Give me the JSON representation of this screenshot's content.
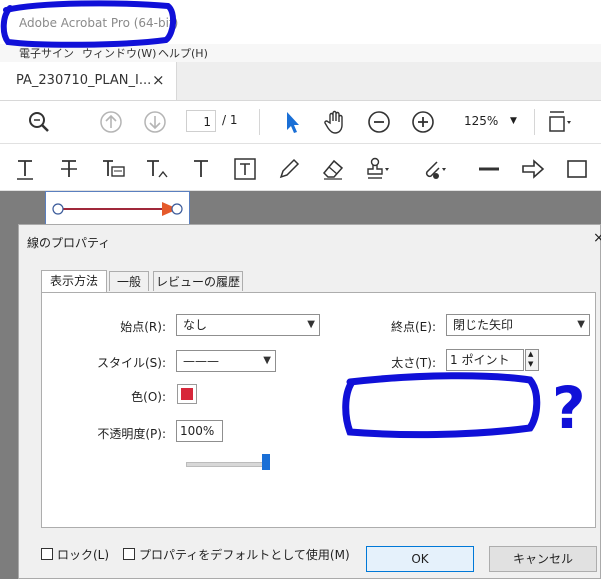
{
  "app": {
    "title": "Adobe Acrobat Pro (64-bit)",
    "menu": [
      "電子サイン",
      "ウィンドウ(W)",
      "ヘルプ(H)"
    ],
    "document_tab": "PA_230710_PLAN_I...",
    "close_tab_glyph": "×"
  },
  "toolbar": {
    "page_current": "1",
    "page_total": "/ 1",
    "zoom": "125%",
    "top_icons": [
      "zoom-icon",
      "previous-page-icon",
      "next-page-icon",
      "select-arrow-icon",
      "hand-icon",
      "zoom-out-icon",
      "zoom-in-icon",
      "fit-page-icon"
    ],
    "comment_icons": [
      "text-insert-icon",
      "strikethrough-icon",
      "replace-text-icon",
      "insert-text-icon",
      "text-box-icon",
      "textbox-frame-icon",
      "pencil-icon",
      "eraser-icon",
      "stamp-icon",
      "attach-icon",
      "line-icon",
      "arrow-icon",
      "rectangle-icon"
    ]
  },
  "dialog": {
    "title": "線のプロパティ",
    "close_glyph": "×",
    "tabs": [
      "表示方法",
      "一般",
      "レビューの履歴"
    ],
    "fields": {
      "start_label": "始点(R):",
      "start_value": "なし",
      "end_label": "終点(E):",
      "end_value": "閉じた矢印",
      "style_label": "スタイル(S):",
      "style_value": "———",
      "thickness_label": "太さ(T):",
      "thickness_value": "1 ポイント",
      "color_label": "色(O):",
      "color_value": "#d7273a",
      "opacity_label": "不透明度(P):",
      "opacity_value": "100%",
      "opacity_fraction": 1.0
    },
    "lock_label": "ロック(L)",
    "default_label": "プロパティをデフォルトとして使用(M)",
    "ok_label": "OK",
    "cancel_label": "キャンセル"
  },
  "annotation": {
    "question_mark": "?",
    "ink_color": "#1010d8"
  }
}
